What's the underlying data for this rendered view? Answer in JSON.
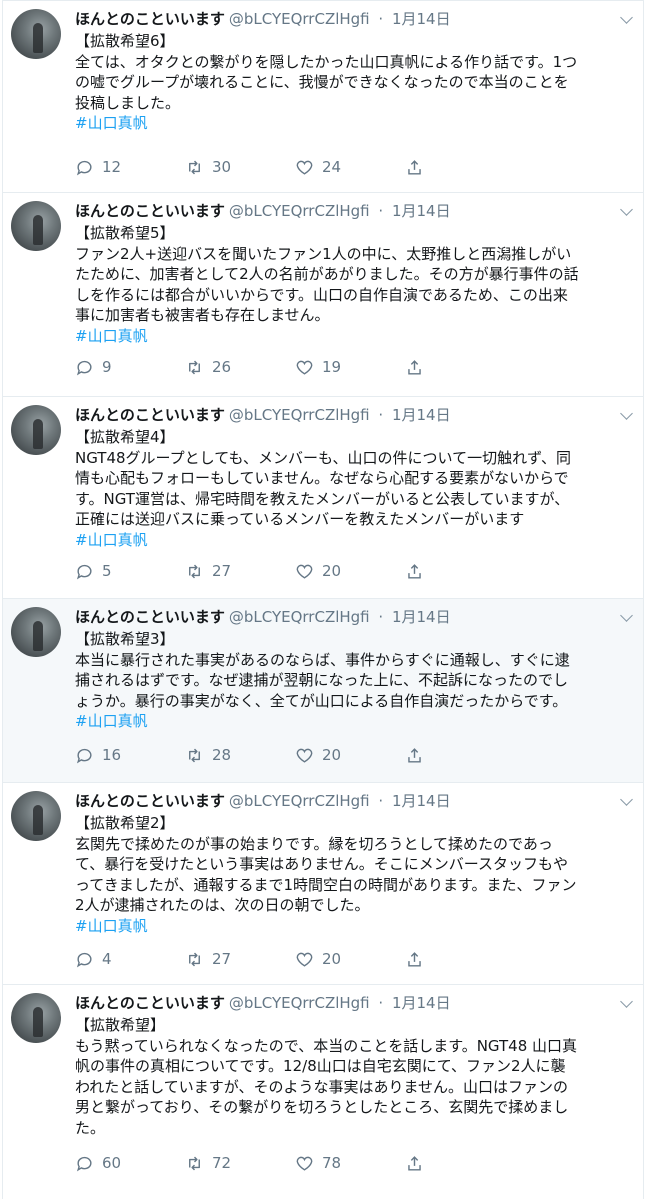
{
  "hashtag": "#山口真帆",
  "tweets": [
    {
      "name": "ほんとのこといいます",
      "handle": "@bLCYEQrrCZlHgfi",
      "date": "1月14日",
      "label": "【拡散希望6】",
      "text": "全ては、オタクとの繋がりを隠したかった山口真帆による作り話です。1つ\nの嘘でグループが壊れることに、我慢ができなくなったので本当のことを\n投稿しました。",
      "replies": "12",
      "retweets": "30",
      "likes": "24"
    },
    {
      "name": "ほんとのこといいます",
      "handle": "@bLCYEQrrCZlHgfi",
      "date": "1月14日",
      "label": "【拡散希望5】",
      "text": "ファン2人+送迎バスを聞いたファン1人の中に、太野推しと西潟推しがい\nたために、加害者として2人の名前があがりました。その方が暴行事件の話\nしを作るには都合がいいからです。山口の自作自演であるため、この出来\n事に加害者も被害者も存在しません。",
      "replies": "9",
      "retweets": "26",
      "likes": "19"
    },
    {
      "name": "ほんとのこといいます",
      "handle": "@bLCYEQrrCZlHgfi",
      "date": "1月14日",
      "label": "【拡散希望4】",
      "text": "NGT48グループとしても、メンバーも、山口の件について一切触れず、同\n情も心配もフォローもしていません。なぜなら心配する要素がないからで\nす。NGT運営は、帰宅時間を教えたメンバーがいると公表していますが、\n正確には送迎バスに乗っているメンバーを教えたメンバーがいます",
      "replies": "5",
      "retweets": "27",
      "likes": "20"
    },
    {
      "name": "ほんとのこといいます",
      "handle": "@bLCYEQrrCZlHgfi",
      "date": "1月14日",
      "label": "【拡散希望3】",
      "text": "本当に暴行された事実があるのならば、事件からすぐに通報し、すぐに逮\n捕されるはずです。なぜ逮捕が翌朝になった上に、不起訴になったのでし\nょうか。暴行の事実がなく、全てが山口による自作自演だったからです。",
      "replies": "16",
      "retweets": "28",
      "likes": "20"
    },
    {
      "name": "ほんとのこといいます",
      "handle": "@bLCYEQrrCZlHgfi",
      "date": "1月14日",
      "label": "【拡散希望2】",
      "text": "玄関先で揉めたのが事の始まりです。縁を切ろうとして揉めたのであっ\nて、暴行を受けたという事実はありません。そこにメンバースタッフもや\nってきましたが、通報するまで1時間空白の時間があります。また、ファン\n2人が逮捕されたのは、次の日の朝でした。",
      "replies": "4",
      "retweets": "27",
      "likes": "20"
    },
    {
      "name": "ほんとのこといいます",
      "handle": "@bLCYEQrrCZlHgfi",
      "date": "1月14日",
      "label": "【拡散希望】",
      "text": "もう黙っていられなくなったので、本当のことを話します。NGT48 山口真\n帆の事件の真相についてです。12/8山口は自宅玄関にて、ファン2人に襲\nわれたと話していますが、そのような事実はありません。山口はファンの\n男と繋がっており、その繋がりを切ろうとしたところ、玄関先で揉めまし\nた。",
      "replies": "60",
      "retweets": "72",
      "likes": "78"
    }
  ]
}
